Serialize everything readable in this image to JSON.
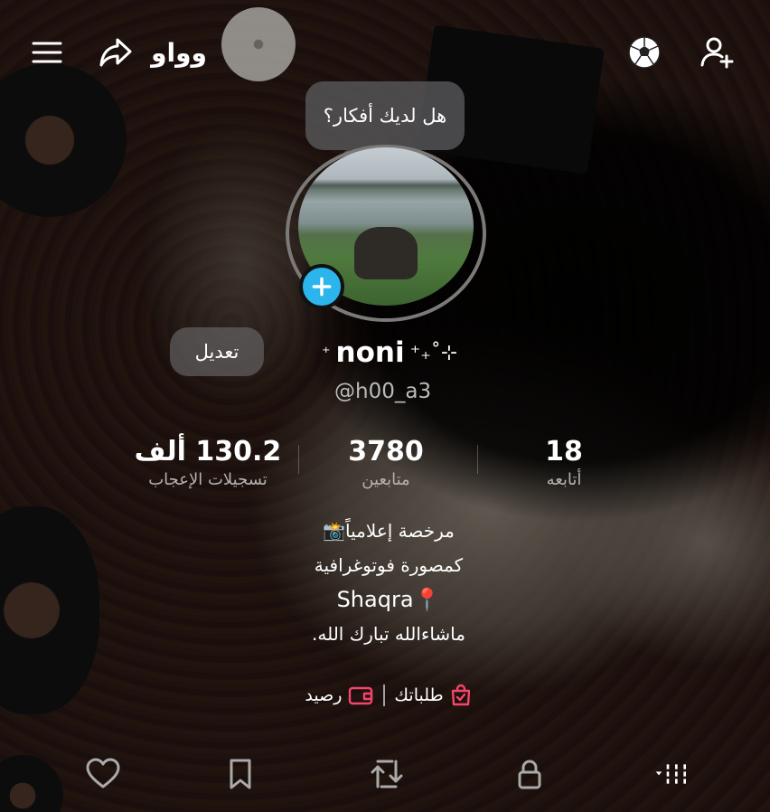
{
  "header": {
    "left_icons": [
      "menu-icon",
      "share-icon",
      "emoji-text-icon"
    ],
    "left_text": "ﻭﻭﺍﻭ",
    "right_icons": [
      "soccer-ball-icon",
      "add-user-icon"
    ]
  },
  "bubble": {
    "text": "هل لديك أفكار؟"
  },
  "profile": {
    "edit_label": "تعديل",
    "display_name": "noni",
    "name_decor_right": "⁺₊˚⊹",
    "name_decor_left": "⁺",
    "username": "@h00_a3"
  },
  "stats": {
    "likes": {
      "value": "130.2 ألف",
      "label": "تسجيلات الإعجاب"
    },
    "followers": {
      "value": "3780",
      "label": "متابعين"
    },
    "following": {
      "value": "18",
      "label": "أتابعه"
    }
  },
  "bio": {
    "lines": [
      "مرخصة إعلامياً📸",
      "كمصورة فوتوغرافية",
      "📍Shaqra",
      "ماشاءالله تبارك الله."
    ]
  },
  "links": {
    "orders": "طلباتك",
    "balance": "رصيد"
  },
  "tabs": [
    "grid-icon",
    "lock-icon",
    "repost-icon",
    "bookmark-icon",
    "heart-icon"
  ],
  "colors": {
    "accent_blue": "#2bb5ec",
    "link_pink": "#f4456b"
  }
}
